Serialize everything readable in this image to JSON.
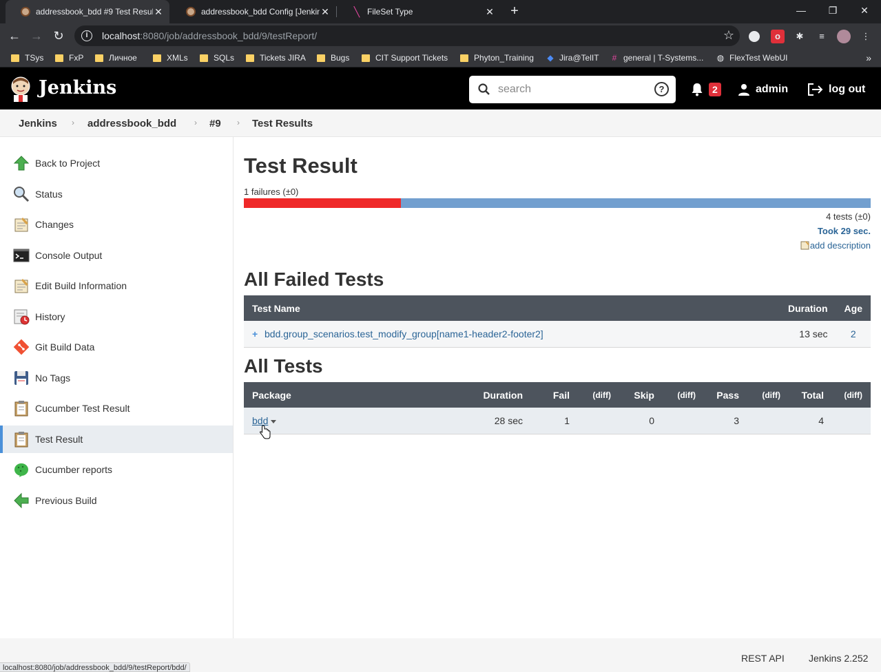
{
  "browser": {
    "tabs": [
      {
        "title": "addressbook_bdd #9 Test Results [Jenkins]",
        "active": true
      },
      {
        "title": "addressbook_bdd Config [Jenkins]",
        "active": false
      },
      {
        "title": "FileSet Type",
        "active": false
      }
    ],
    "new_tab": "+",
    "window_controls": {
      "minimize": "—",
      "restore": "❐",
      "close": "✕"
    },
    "url_host": "localhost",
    "url_path": ":8080/job/addressbook_bdd/9/testReport/",
    "bookmarks": [
      "TSys",
      "FxP",
      "Личное",
      "XMLs",
      "SQLs",
      "Tickets JIRA",
      "Bugs",
      "CIT Support Tickets",
      "Phyton_Training",
      "Jira@TelIT",
      "general | T-Systems...",
      "FlexTest WebUI"
    ],
    "bookmarks_more": "»"
  },
  "header": {
    "title": "Jenkins",
    "search_placeholder": "search",
    "help": "?",
    "notification_count": "2",
    "user": "admin",
    "logout": "log out"
  },
  "breadcrumb": [
    "Jenkins",
    "addressbook_bdd",
    "#9",
    "Test Results"
  ],
  "sidebar": {
    "items": [
      {
        "label": "Back to Project"
      },
      {
        "label": "Status"
      },
      {
        "label": "Changes"
      },
      {
        "label": "Console Output"
      },
      {
        "label": "Edit Build Information"
      },
      {
        "label": "History"
      },
      {
        "label": "Git Build Data"
      },
      {
        "label": "No Tags"
      },
      {
        "label": "Cucumber Test Result"
      },
      {
        "label": "Test Result",
        "active": true
      },
      {
        "label": "Cucumber reports"
      },
      {
        "label": "Previous Build"
      }
    ]
  },
  "main": {
    "title": "Test Result",
    "failures_summary": "1 failures (±0)",
    "fail_fraction": 0.25,
    "tests_summary": "4 tests (±0)",
    "took": "Took 29 sec.",
    "add_description": "add description",
    "failed_heading": "All Failed Tests",
    "failed_table": {
      "headers": [
        "Test Name",
        "Duration",
        "Age"
      ],
      "rows": [
        {
          "name": "bdd.group_scenarios.test_modify_group[name1-header2-footer2]",
          "duration": "13 sec",
          "age": "2"
        }
      ]
    },
    "all_heading": "All Tests",
    "all_table": {
      "headers": [
        "Package",
        "Duration",
        "Fail",
        "(diff)",
        "Skip",
        "(diff)",
        "Pass",
        "(diff)",
        "Total",
        "(diff)"
      ],
      "rows": [
        {
          "package": "bdd",
          "duration": "28 sec",
          "fail": "1",
          "fail_diff": "",
          "skip": "0",
          "skip_diff": "",
          "pass": "3",
          "pass_diff": "",
          "total": "4",
          "total_diff": ""
        }
      ]
    }
  },
  "footer": {
    "rest_api": "REST API",
    "version": "Jenkins 2.252"
  },
  "status_bar": "localhost:8080/job/addressbook_bdd/9/testReport/bdd/",
  "colors": {
    "fail": "#ef2929",
    "pass": "#729fcf",
    "link": "#2a6496",
    "table_header": "#4d545d"
  }
}
